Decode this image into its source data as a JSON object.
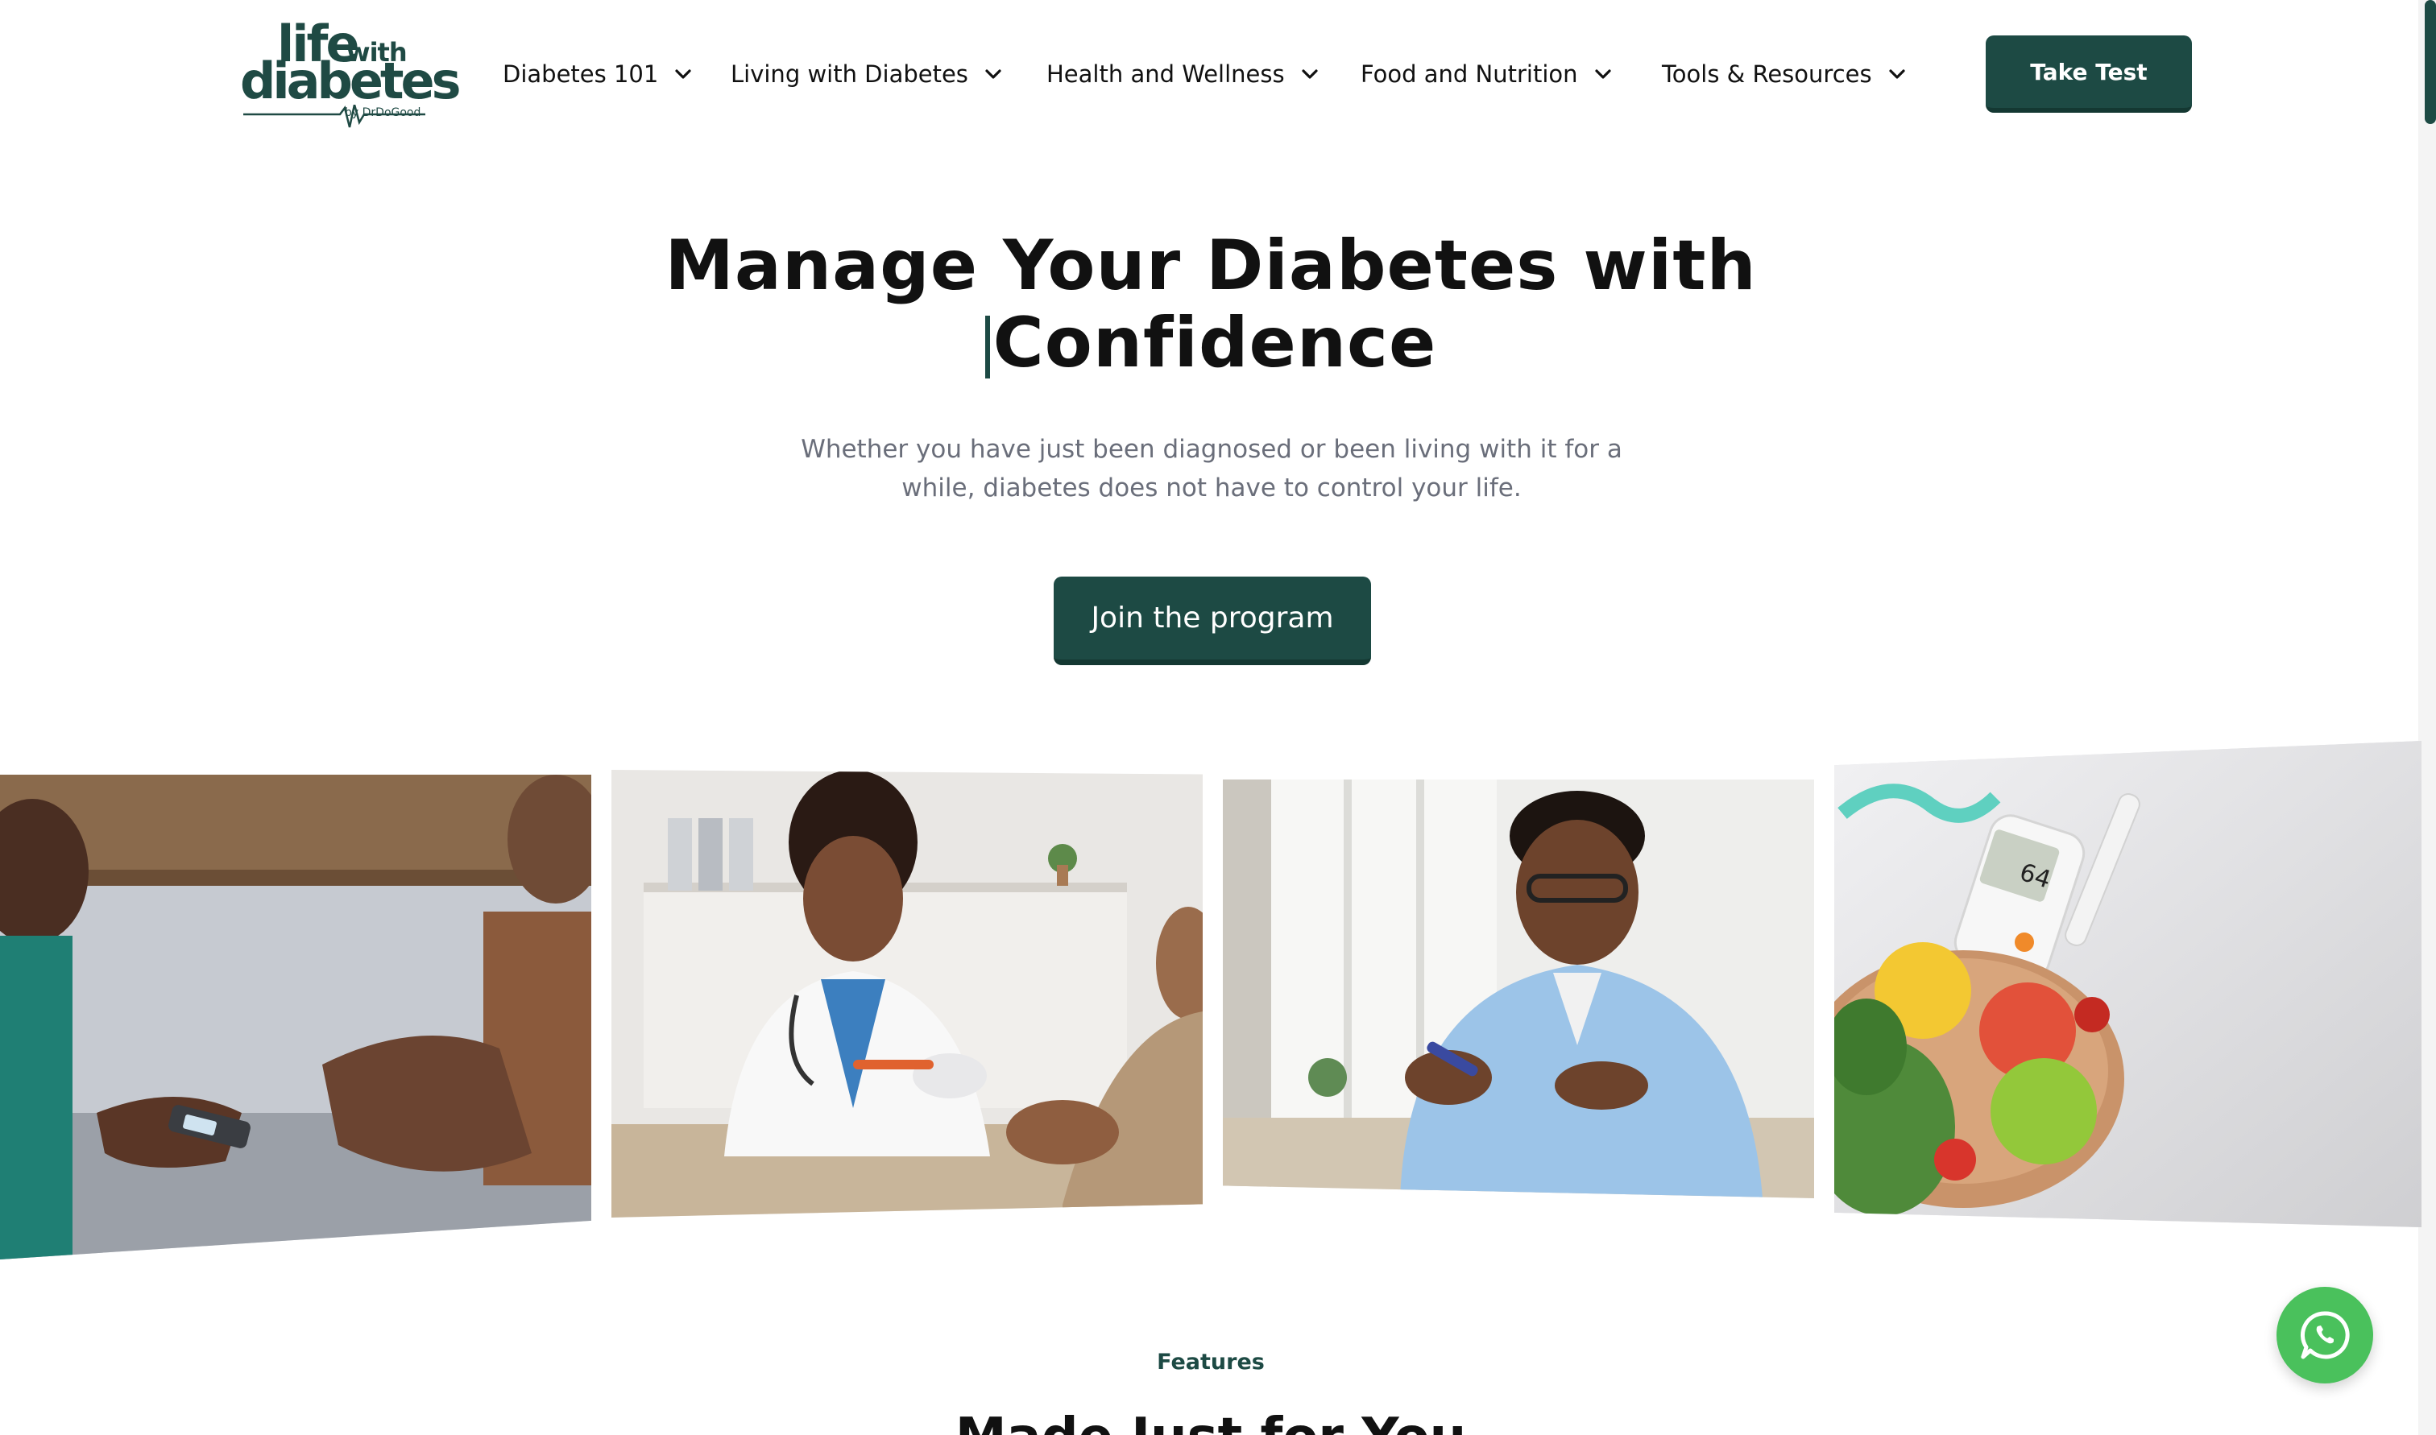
{
  "header": {
    "logo": {
      "word_life": "life",
      "word_with": "with",
      "word_diabetes": "diabetes",
      "byline": "by DrDoGood"
    },
    "nav": [
      {
        "label": "Diabetes 101",
        "icon": "chevron-down-icon"
      },
      {
        "label": "Living with Diabetes",
        "icon": "chevron-down-icon"
      },
      {
        "label": "Health and Wellness",
        "icon": "chevron-down-icon"
      },
      {
        "label": "Food and Nutrition",
        "icon": "chevron-down-icon"
      },
      {
        "label": "Tools & Resources",
        "icon": "chevron-down-icon"
      }
    ],
    "cta_label": "Take Test"
  },
  "hero": {
    "title_line1": "Manage Your Diabetes with",
    "title_highlight": "Confidence",
    "subtitle_line1": "Whether you have just been diagnosed or been living with it for a",
    "subtitle_line2": "while, diabetes does not have to control your life.",
    "button_label": "Join the program"
  },
  "gallery": {
    "images": [
      {
        "subject": "nurse checking glucose meter with patient"
      },
      {
        "subject": "doctor pricking finger of senior patient"
      },
      {
        "subject": "man using glucose lancet at home"
      },
      {
        "subject": "glucose meter reading 64 with fruit bowl and tape measure",
        "meter_reading": "64"
      }
    ]
  },
  "features": {
    "label": "Features",
    "title": "Made Just for You"
  },
  "floating": {
    "icon": "whatsapp-icon"
  },
  "colors": {
    "brand": "#1d4a44",
    "brand_dark": "#143832",
    "text": "#111111",
    "muted": "#6a6e7a",
    "highlight": "#dcefea",
    "whatsapp": "#4ac15c"
  }
}
